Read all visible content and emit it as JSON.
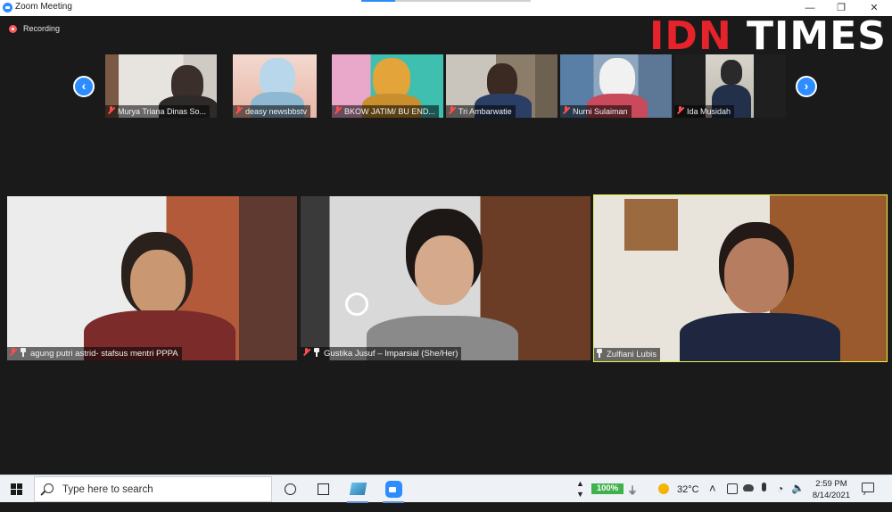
{
  "window": {
    "title": "Zoom Meeting",
    "minimize": "—",
    "restore": "❐",
    "close": "✕"
  },
  "recording": {
    "label": "Recording"
  },
  "watermark": {
    "text_a": "IDN",
    "text_b": "TIMES"
  },
  "gallery": {
    "prev": "‹",
    "next": "›",
    "participants": [
      {
        "name": "Murya Triana Dinas So...",
        "muted": true
      },
      {
        "name": "deasy newsbbstv",
        "muted": true
      },
      {
        "name": "BKOW JATIM/ BU END...",
        "muted": true
      },
      {
        "name": "Tri Ambarwatie",
        "muted": true
      },
      {
        "name": "Nurni Sulaiman",
        "muted": true
      },
      {
        "name": "Ida Musidah",
        "muted": true
      }
    ]
  },
  "main": {
    "tiles": [
      {
        "name": "agung putri astrid- stafsus mentri PPPA",
        "muted": true,
        "pinned": true,
        "active": false
      },
      {
        "name": "Gustika Jusuf – Imparsial (She/Her)",
        "muted": true,
        "pinned": true,
        "active": false
      },
      {
        "name": "Zulfiani Lubis",
        "muted": false,
        "pinned": true,
        "active": true
      }
    ]
  },
  "taskbar": {
    "search_placeholder": "Type here to search",
    "battery": "100%",
    "temperature": "32°C",
    "time": "2:59 PM",
    "date": "8/14/2021",
    "tray_chevron": "˄"
  },
  "colors": {
    "zoom_blue": "#2d8cff",
    "active_speaker": "#e8f54a",
    "muted_red": "#ff4c4c",
    "brand_red": "#e4232a"
  }
}
